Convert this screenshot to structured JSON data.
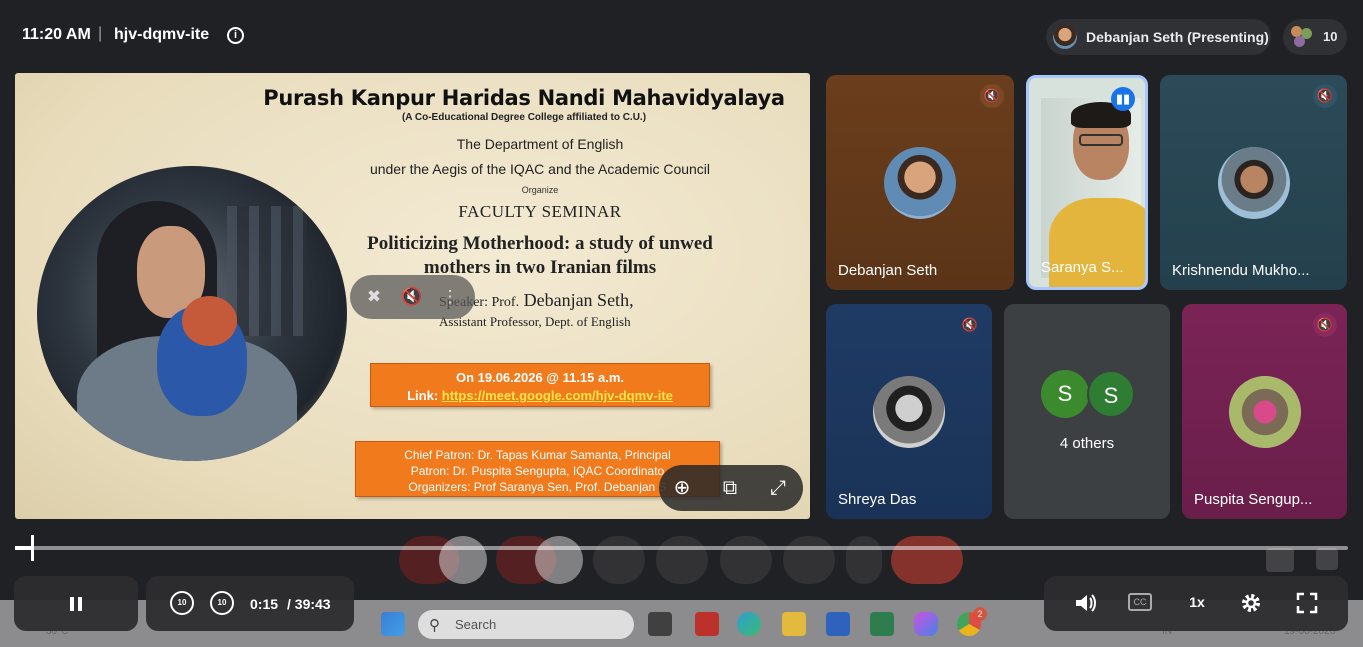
{
  "topbar": {
    "time": "11:20 AM",
    "separator": "|",
    "meeting_code": "hjv-dqmv-ite",
    "presenter_label": "Debanjan Seth (Presenting)",
    "participant_count": "10"
  },
  "slide": {
    "title": "Purash Kanpur Haridas Nandi Mahavidyalaya",
    "subtitle": "(A Co-Educational Degree College affiliated to C.U.)",
    "department": "The Department of  English",
    "aegis": "under the Aegis of the IQAC and the Academic Council",
    "organize": "Organize",
    "seminar": "FACULTY SEMINAR",
    "topic": "Politicizing Motherhood: a study of unwed mothers in two Iranian films",
    "speaker_prefix": "Speaker: Prof.",
    "speaker_name": "Debanjan Seth,",
    "speaker_role": "Assistant Professor, Dept. of English",
    "date_line": "On 19.06.2026 @ 11.15 a.m.",
    "link_label": "Link:",
    "link_url": "https://meet.google.com/hjv-dqmv-ite",
    "chief_patron": "Chief Patron: Dr. Tapas Kumar Samanta, Principal",
    "patron": "Patron: Dr. Puspita Sengupta,  IQAC Coordinato",
    "organizers": "Organizers: Prof Saranya Sen, Prof. Debanjan S"
  },
  "tiles": [
    {
      "name": "Debanjan Seth"
    },
    {
      "name": "Saranya S..."
    },
    {
      "name": "Krishnendu Mukho..."
    },
    {
      "name": "Shreya Das"
    },
    {
      "name": "4 others",
      "initials": [
        "S",
        "S"
      ]
    },
    {
      "name": "Puspita Sengup..."
    }
  ],
  "player": {
    "current_time": "0:15",
    "total_time": "/ 39:43",
    "progress_fraction": 0.012,
    "speed": "1x",
    "rewind_label": "10",
    "forward_label": "10"
  },
  "taskbar": {
    "search_placeholder": "Search",
    "weather": "30°C",
    "lang": "IN",
    "date": "19-06-2026",
    "chrome_badge": "2"
  },
  "colors": {
    "meet_bg": "#202124",
    "banner_orange": "#f07a1c",
    "end_call_red": "#ea4335",
    "active_speaker": "#a8c7fa"
  }
}
